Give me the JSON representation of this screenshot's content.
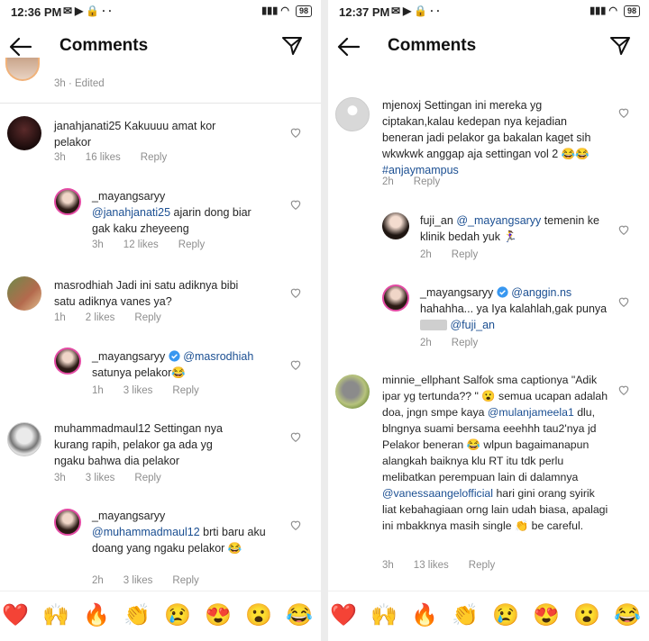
{
  "left": {
    "time": "12:36 PM",
    "battery": "98",
    "title": "Comments",
    "top_meta": "3h · Edited",
    "comments": [
      {
        "user": "janahjanati25",
        "text": "Kakuuuu amat kor pelakor",
        "time": "3h",
        "likes": "16 likes",
        "reply": "Reply"
      },
      {
        "user": "_mayangsaryy",
        "mention": "@janahjanati25",
        "text": "ajarin dong biar gak kaku zheyeeng",
        "time": "3h",
        "likes": "12 likes",
        "reply": "Reply"
      },
      {
        "user": "masrodhiah",
        "text": "Jadi ini satu adiknya bibi satu adiknya vanes ya?",
        "time": "1h",
        "likes": "2 likes",
        "reply": "Reply"
      },
      {
        "user": "_mayangsaryy",
        "mention": "@masrodhiah",
        "text": "satunya pelakor😂",
        "time": "1h",
        "likes": "3 likes",
        "reply": "Reply"
      },
      {
        "user": "muhammadmaul12",
        "text": "Settingan nya kurang rapih, pelakor ga ada yg ngaku bahwa dia pelakor",
        "time": "3h",
        "likes": "3 likes",
        "reply": "Reply"
      },
      {
        "user": "_mayangsaryy",
        "mention": "@muhammadmaul12",
        "text": "brti baru aku doang yang ngaku pelakor 😂",
        "time": "2h",
        "likes": "3 likes",
        "reply": "Reply"
      }
    ]
  },
  "right": {
    "time": "12:37 PM",
    "battery": "98",
    "title": "Comments",
    "comments": [
      {
        "user": "mjenoxj",
        "text": "Settingan ini mereka yg ciptakan,kalau kedepan nya kejadian beneran jadi pelakor ga bakalan kaget sih wkwkwk anggap aja settingan vol 2 😂😂",
        "tag": "#anjaymampus",
        "time": "2h",
        "reply": "Reply"
      },
      {
        "user": "fuji_an",
        "mention": "@_mayangsaryy",
        "text": "temenin ke klinik bedah yuk 🏃‍♀️",
        "time": "2h",
        "reply": "Reply"
      },
      {
        "user": "_mayangsaryy",
        "mention": "@anggin.ns",
        "text": "hahahha... ya Iya kalahlah,gak punya",
        "mention2": "@fuji_an",
        "time": "2h",
        "reply": "Reply"
      },
      {
        "user": "minnie_ellphant",
        "text1": "Salfok sma captionya \"Adik ipar yg tertunda?? \" 😮 semua ucapan adalah doa, jngn smpe kaya",
        "mention": "@mulanjameela1",
        "text2": "dlu, blngnya suami bersama eeehhh tau2'nya jd Pelakor beneran 😂 wlpun bagaimanapun alangkah baiknya klu RT itu tdk perlu melibatkan perempuan lain di dalamnya",
        "mention2": "@vanessaangelofficial",
        "text3": "hari gini orang syirik liat kebahagiaan orng lain udah biasa, apalagi ini mbakknya masih single 👏 be careful.",
        "time": "3h",
        "likes": "13 likes",
        "reply": "Reply"
      }
    ]
  },
  "emojis": [
    "❤️",
    "🙌",
    "🔥",
    "👏",
    "😢",
    "😍",
    "😮",
    "😂"
  ]
}
